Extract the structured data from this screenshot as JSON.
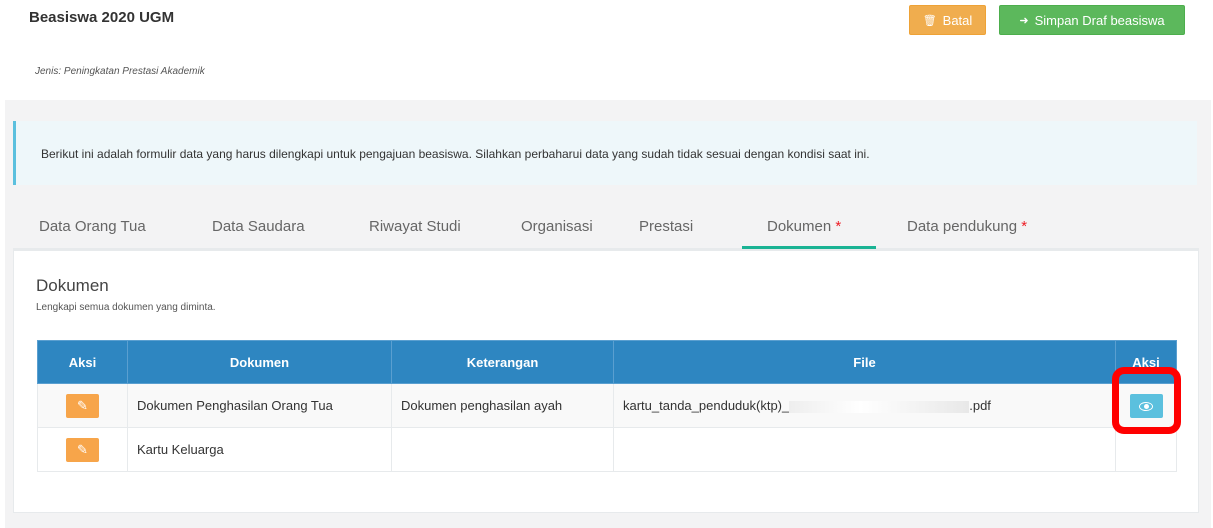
{
  "header": {
    "title": "Beasiswa 2020 UGM",
    "subtitle": "Jenis: Peningkatan Prestasi Akademik",
    "batal_label": "Batal",
    "simpan_label": "Simpan Draf beasiswa"
  },
  "alert": {
    "text": "Berikut ini adalah formulir data yang harus dilengkapi untuk pengajuan beasiswa. Silahkan perbaharui data yang sudah tidak sesuai dengan kondisi saat ini."
  },
  "tabs": [
    {
      "label": "Data Orang Tua",
      "required": ""
    },
    {
      "label": "Data Saudara",
      "required": ""
    },
    {
      "label": "Riwayat Studi",
      "required": ""
    },
    {
      "label": "Organisasi",
      "required": ""
    },
    {
      "label": "Prestasi",
      "required": ""
    },
    {
      "label": "Dokumen",
      "required": "*"
    },
    {
      "label": "Data pendukung",
      "required": "*"
    }
  ],
  "active_tab": "Dokumen",
  "section": {
    "title": "Dokumen",
    "subtitle": "Lengkapi semua dokumen yang diminta."
  },
  "table": {
    "headers": [
      "Aksi",
      "Dokumen",
      "Keterangan",
      "File",
      "Aksi"
    ],
    "rows": [
      {
        "dokumen": "Dokumen Penghasilan Orang Tua",
        "keterangan": "Dokumen penghasilan ayah",
        "file_prefix": "kartu_tanda_penduduk(ktp)_",
        "file_suffix": ".pdf"
      },
      {
        "dokumen": "Kartu Keluarga",
        "keterangan": "",
        "file_prefix": "",
        "file_suffix": ""
      }
    ]
  },
  "icons": {
    "batal": "trash-icon",
    "simpan": "arrow-right-icon",
    "edit": "edit-icon",
    "view": "eye-icon"
  },
  "colors": {
    "batal": "#f0ad4e",
    "simpan": "#5cb85c",
    "table_header": "#2e86c1",
    "alert_border": "#5bc0de",
    "active_tab": "#1ab394",
    "highlight": "#ff0000"
  }
}
